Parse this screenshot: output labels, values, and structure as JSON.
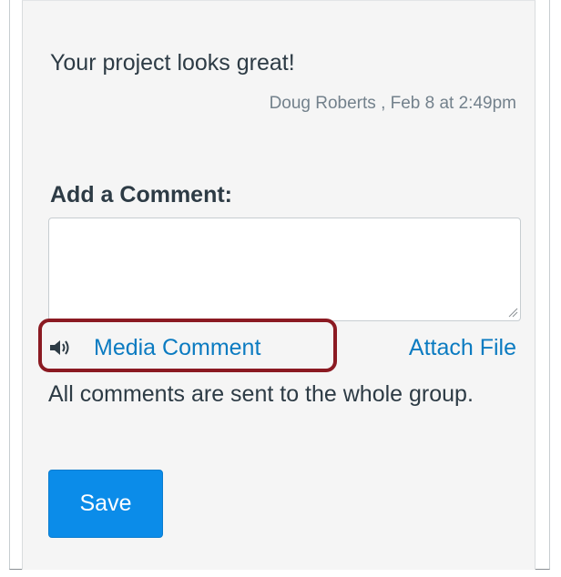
{
  "comment": {
    "text": "Your project looks great!",
    "meta": "Doug Roberts , Feb 8 at 2:49pm"
  },
  "add_comment": {
    "heading": "Add a Comment:",
    "textarea_value": "",
    "media_icon": "speaker-icon",
    "media_label": "Media Comment",
    "attach_label": "Attach File",
    "note": "All comments are sent to the whole group.",
    "save_label": "Save"
  },
  "colors": {
    "link": "#0b7bc1",
    "button": "#0b8ce9",
    "highlight": "#8b1a22",
    "text": "#2d3b45",
    "meta_text": "#73818c"
  }
}
